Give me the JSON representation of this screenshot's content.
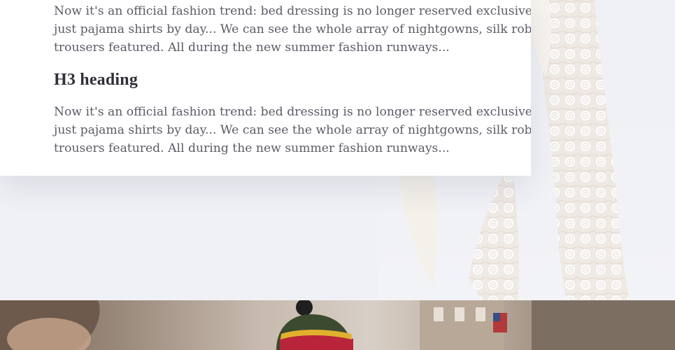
{
  "content": {
    "paragraph_1": "Now it's an official fashion trend: bed dressing is no longer reserved exclusively fo\njust pajama shirts by day... We can see the whole array of nightgowns, silk robes, s\ntrousers featured. All during the new summer fashion runways...",
    "heading": "H3 heading",
    "paragraph_2": "Now it's an official fashion trend: bed dressing is no longer reserved exclusively fo\njust pajama shirts by day... We can see the whole array of nightgowns, silk robes, s\ntrousers featured. All during the new summer fashion runways..."
  },
  "colors": {
    "page_background": "#f0f1f6",
    "card_background": "#ffffff",
    "body_text": "#5b5b66",
    "heading_text": "#2f3037"
  },
  "images": {
    "lace_figure": "fashion-lace-legs-image",
    "street_photo": "street-beanie-photo"
  }
}
